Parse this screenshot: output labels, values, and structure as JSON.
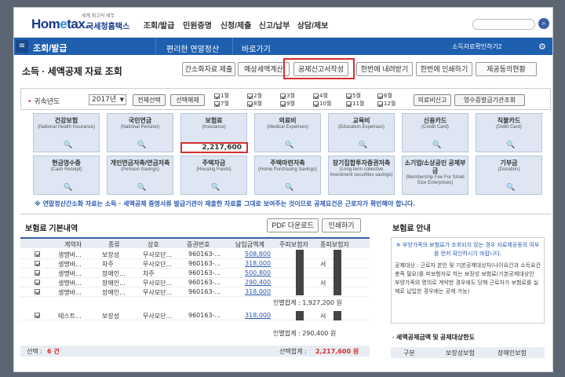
{
  "header": {
    "logo": {
      "main": "Hom",
      "dot": "e",
      "rest": "tax.",
      "tagline": "세계 최고의 세무",
      "korean": "국세청홈택스"
    },
    "nav": [
      "조회/발급",
      "민원증명",
      "신청/제출",
      "신고/납부",
      "상담/제보"
    ],
    "search_placeholder": ""
  },
  "bluebar": {
    "section": "조회/발급",
    "crumb1": "편리한 연말정산",
    "crumb2": "바로가기",
    "right": "소득자료확인하기2"
  },
  "page": {
    "title": "소득 · 세액공제 자료 조회",
    "buttons": [
      "간소화자료 제출",
      "예상세액계산",
      "공제신고서작성",
      "한번에 내려받기",
      "한번에 인쇄하기",
      "제공동의현황"
    ]
  },
  "filter": {
    "year_label": "귀속년도",
    "year_value": "2017년",
    "select_all": "전체선택",
    "deselect": "선택해제",
    "months": [
      "1월",
      "2월",
      "3월",
      "4월",
      "5월",
      "6월",
      "7월",
      "8월",
      "9월",
      "10월",
      "11월",
      "12월"
    ],
    "medical": "의료비신고",
    "blurred_btn": "영수증발급기관조회"
  },
  "tiles": [
    {
      "title": "건강보험",
      "sub": "(National Health Insurance)"
    },
    {
      "title": "국민연금",
      "sub": "(National Pension)"
    },
    {
      "title": "보험료",
      "sub": "(Insurance)"
    },
    {
      "title": "의료비",
      "sub": "(Medical Expenses)"
    },
    {
      "title": "교육비",
      "sub": "(Education Expenses)"
    },
    {
      "title": "신용카드",
      "sub": "(Credit Card)"
    },
    {
      "title": "직불카드",
      "sub": "(Debit Card)"
    },
    {
      "title": "현금영수증",
      "sub": "(Cash Receipt)"
    },
    {
      "title": "개인연금저축/연금저축",
      "sub": "(Pension Savings)"
    },
    {
      "title": "주택자금",
      "sub": "(Housing Funds)"
    },
    {
      "title": "주택마련저축",
      "sub": "(Home Purchasing Savings)"
    },
    {
      "title": "장기집합투자증권저축",
      "sub": "(Long-term collective investment securities savings)"
    },
    {
      "title": "소기업/소상공인 공제부금",
      "sub": "(Membership Fee For Small Size Enterprises)"
    },
    {
      "title": "기부금",
      "sub": "(Donation)"
    }
  ],
  "insurance_value": "2,217,600",
  "notice": "※ 연말정산간소화 자료는 소득 · 세액공제 증명서류 발급기관이 제출한 자료를 그대로 보여주는 것이므로 공제요건은 근로자가 확인해야 합니다.",
  "details": {
    "title": "보험료 기본내역",
    "pdf_btn": "PDF 다운로드",
    "print_btn": "인쇄하기",
    "headers": [
      "계약자",
      "종류",
      "상호",
      "증권번호",
      "납입금액계",
      "주피보험자",
      "종피보험자"
    ],
    "rows": [
      {
        "contractor": "생명바...",
        "type": "보장성",
        "company": "무사모단...",
        "policy": "960163-...",
        "amount": "508,800",
        "insured": "",
        "sub": ""
      },
      {
        "contractor": "생명바...",
        "type": "차주",
        "company": "무사모단...",
        "policy": "960163-...",
        "amount": "318,000",
        "insured": "서",
        "sub": ""
      },
      {
        "contractor": "생명바...",
        "type": "장애인...",
        "company": "차주",
        "policy": "960163-...",
        "amount": "500,800",
        "insured": "",
        "sub": ""
      },
      {
        "contractor": "생명바...",
        "type": "장애인...",
        "company": "무사모단...",
        "policy": "960163-...",
        "amount": "290,400",
        "insured": "서",
        "sub": ""
      },
      {
        "contractor": "생명바...",
        "type": "장애인...",
        "company": "무사모단...",
        "policy": "960163-...",
        "amount": "318,000",
        "insured": "",
        "sub": ""
      }
    ],
    "subtotal1": "인별합계 : 1,927,200 원",
    "extra_row": {
      "contractor": "테스트...",
      "type": "보장성",
      "company": "무사모단...",
      "policy": "960163-...",
      "amount": "318,000",
      "insured": "서",
      "sub": ""
    },
    "subtotal2": "인별합계 : 290,400 원",
    "footer_left_label": "선택 :",
    "footer_left_value": "6 건",
    "footer_right_label": "선택합계 :",
    "footer_right_value": "2,217,600 원"
  },
  "guide": {
    "title": "보험료 안내",
    "p1": "※ 부양가족의 보험료가 조회되지 않는 경우 자료제공동의 여부를 먼저 확인하시기 바랍니다.",
    "p2": "공제대상 : 근로자 본인 및 기본공제대상자(나이요건과 소득요건 충족 필요)를 피보험자로 하는 보장성 보험료(기본공제대상인 부양가족의 명의로 계약한 경우에도 당해 근로자가 보험료를 실제로 납입한 경우에는 공제 가능)",
    "table_title": "· 세액공제금액 및 공제대상한도",
    "table_headers": [
      "구분",
      "보장성보험",
      "장애인보험"
    ]
  }
}
